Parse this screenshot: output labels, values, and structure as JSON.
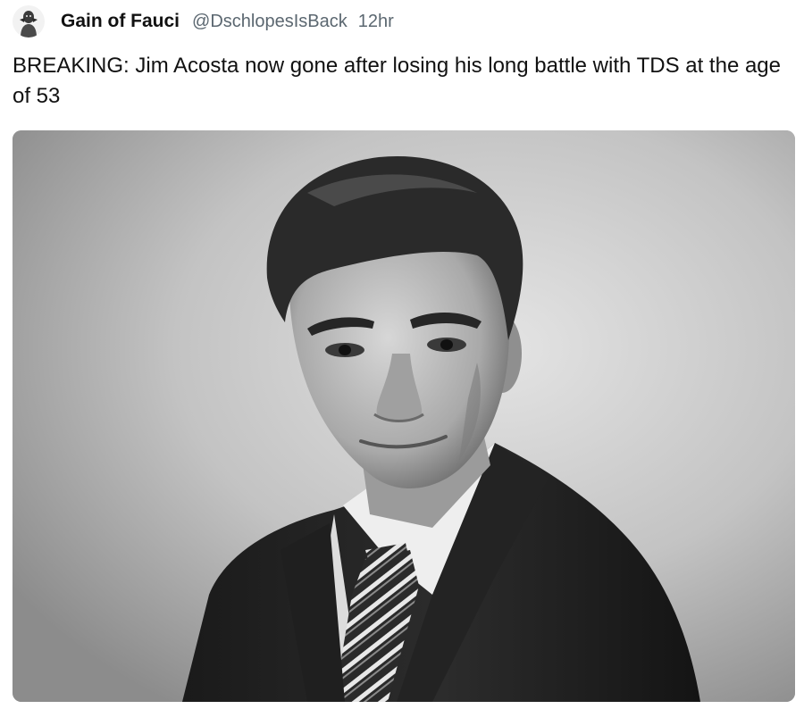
{
  "post": {
    "author": {
      "display_name": "Gain of Fauci",
      "handle": "@DschlopesIsBack",
      "avatar_icon": "avatar-icon"
    },
    "timestamp": "12hr",
    "text": "BREAKING: Jim Acosta now gone after losing his long battle with TDS at the age of 53",
    "media": {
      "type": "photo",
      "style": "black-and-white portrait"
    }
  }
}
